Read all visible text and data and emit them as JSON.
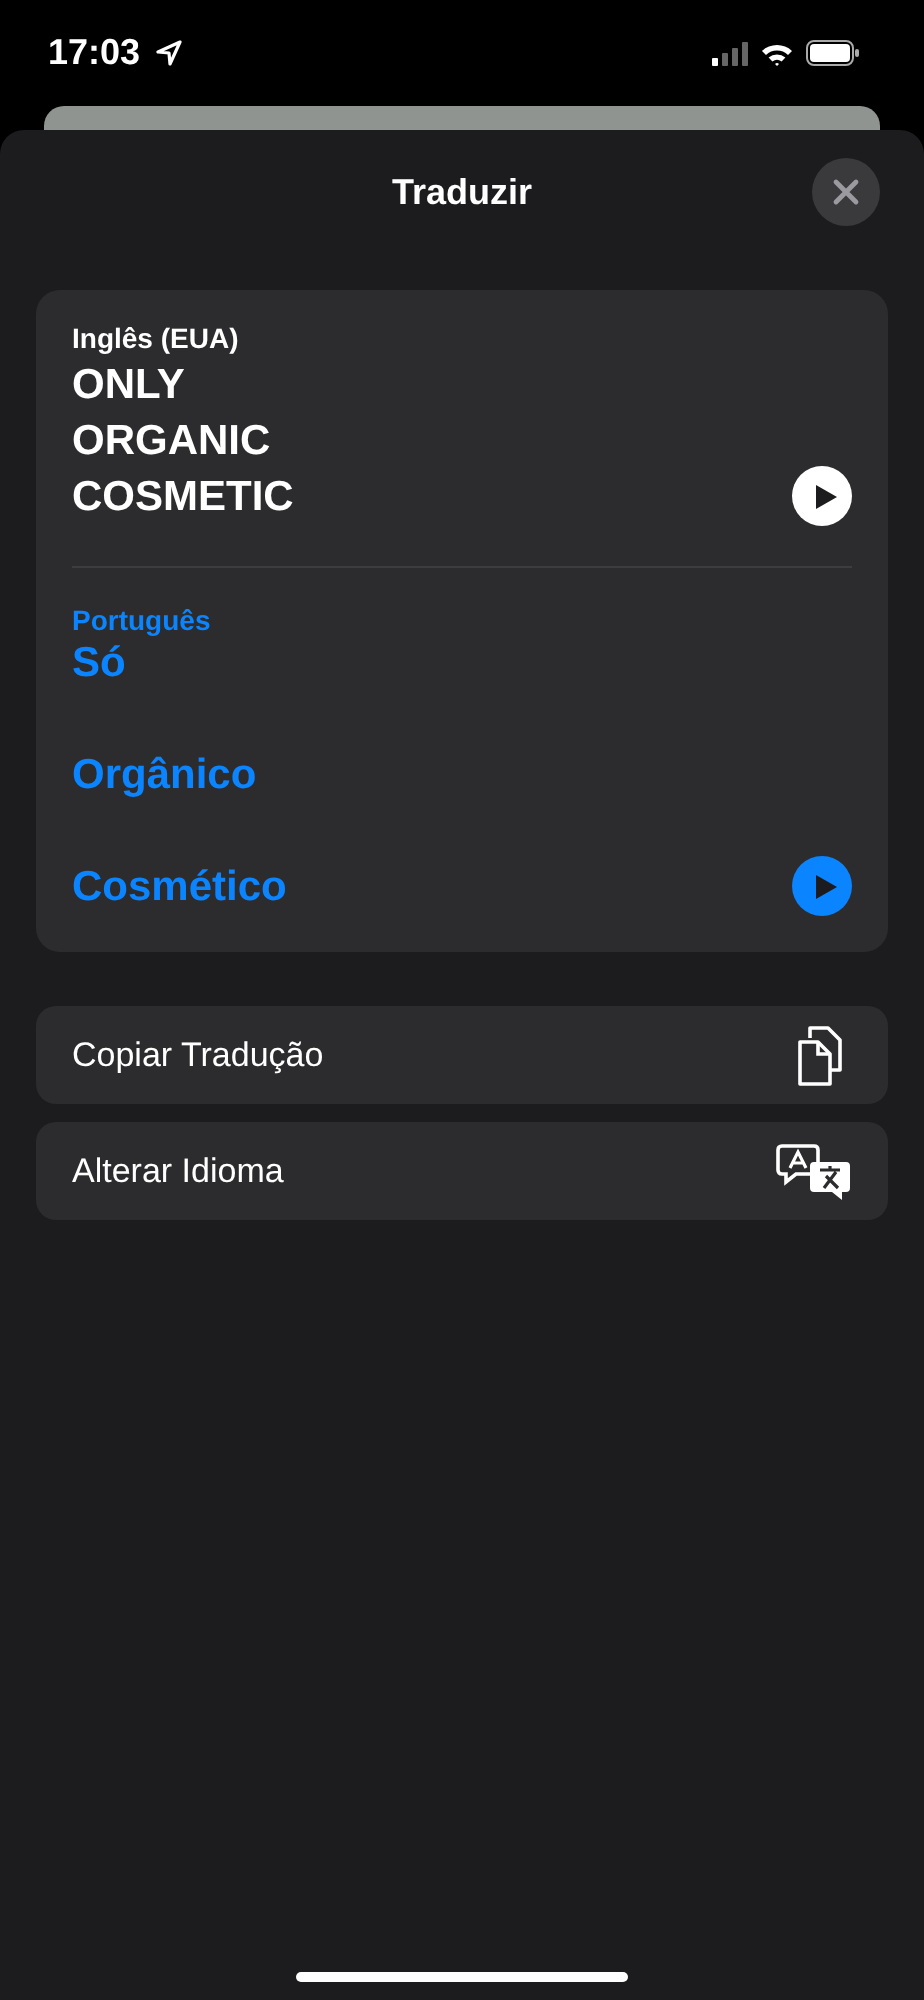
{
  "status_bar": {
    "time": "17:03"
  },
  "sheet": {
    "title": "Traduzir"
  },
  "source": {
    "language": "Inglês (EUA)",
    "lines": [
      "ONLY",
      "ORGANIC",
      "COSMETIC"
    ]
  },
  "target": {
    "language": "Português",
    "lines": [
      "Só",
      "Orgânico",
      "Cosmético"
    ]
  },
  "actions": [
    {
      "label": "Copiar Tradução",
      "kind": "copy"
    },
    {
      "label": "Alterar Idioma",
      "kind": "language"
    }
  ]
}
